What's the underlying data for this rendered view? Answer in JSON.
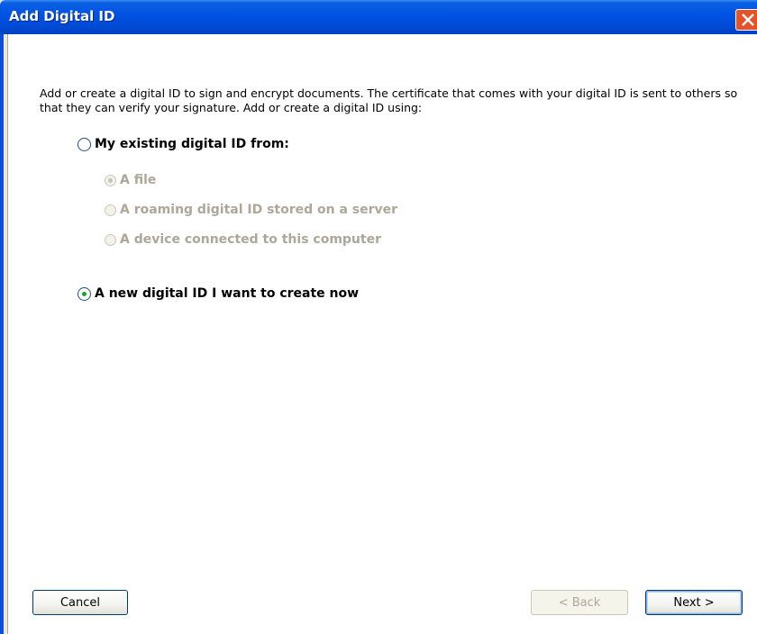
{
  "window": {
    "title": "Add Digital ID"
  },
  "intro_text": "Add or create a digital ID to sign and encrypt documents. The certificate that comes with your digital ID is sent to others so that they can verify your signature. Add or create a digital ID using:",
  "options": {
    "existing": {
      "label": "My existing digital ID from:",
      "selected": false
    },
    "sub_options": [
      {
        "label": "A file",
        "selected": true,
        "enabled": false
      },
      {
        "label": "A roaming digital ID stored on a server",
        "selected": false,
        "enabled": false
      },
      {
        "label": "A device connected to this computer",
        "selected": false,
        "enabled": false
      }
    ],
    "new_id": {
      "label": "A new digital ID I want to create now",
      "selected": true
    }
  },
  "buttons": {
    "cancel": "Cancel",
    "back": "< Back",
    "next": "Next >"
  },
  "colors": {
    "title_bar": "#0054e3",
    "close_button": "#e5532b",
    "radio_selected": "#21a121",
    "disabled_text": "#aca899"
  }
}
